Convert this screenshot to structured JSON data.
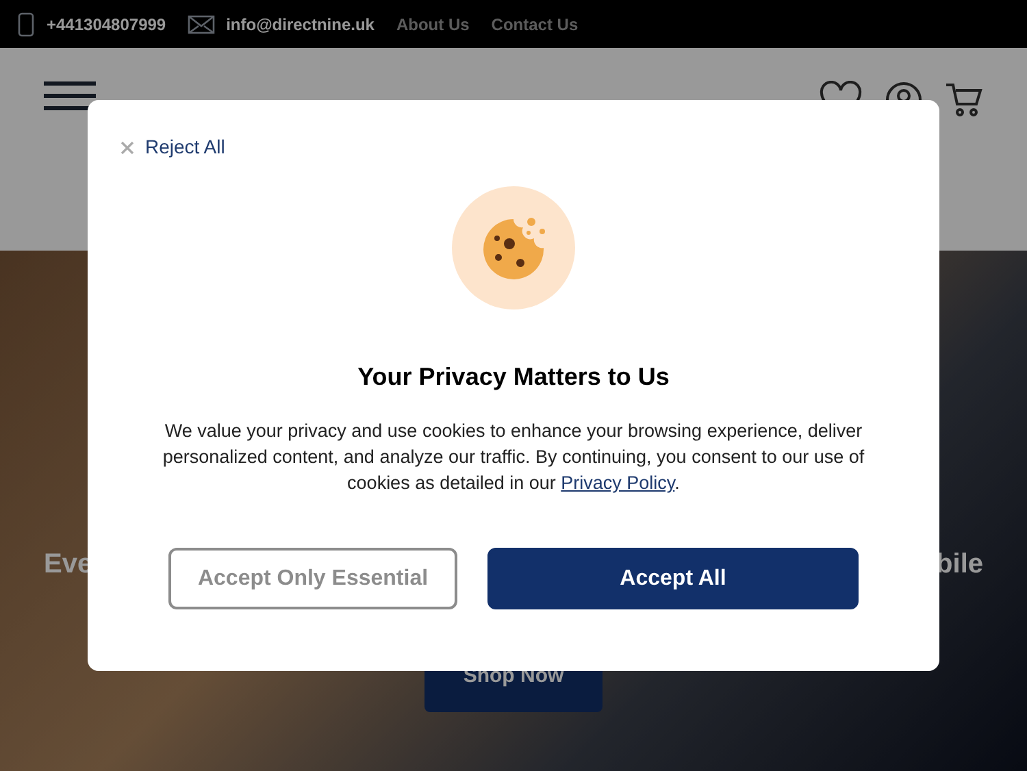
{
  "topbar": {
    "phone": "+441304807999",
    "email": "info@directnine.uk",
    "links": [
      "About Us",
      "Contact Us"
    ]
  },
  "hero": {
    "heading_left": "Eve",
    "heading_right": "bile",
    "button": "Shop Now"
  },
  "dialog": {
    "reject": "Reject All",
    "title": "Your Privacy Matters to Us",
    "body": "We value your privacy and use cookies to enhance your browsing experience, deliver personalized content, and analyze our traffic. By continuing, you consent to our use of cookies as detailed in our ",
    "link": "Privacy Policy",
    "body_end": ".",
    "buttons": [
      {
        "label": "Accept Only Essential",
        "kind": "outline"
      },
      {
        "label": "Accept All",
        "kind": "primary"
      }
    ]
  }
}
